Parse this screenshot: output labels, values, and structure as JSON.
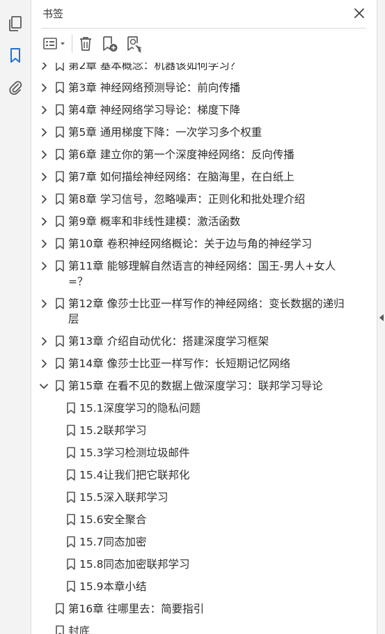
{
  "rail": {
    "items": [
      {
        "icon": "pages-icon"
      },
      {
        "icon": "bookmark-icon",
        "active": true
      },
      {
        "icon": "paperclip-icon"
      }
    ]
  },
  "panel": {
    "title": "书签"
  },
  "colors": {
    "icon": "#5a5a5a",
    "active_icon": "#1473e6",
    "text": "#2c2c2c",
    "scroll_thumb": "#c2c2c2"
  },
  "bookmarks": [
    {
      "label": "第2章 基本概念：机器该如何学习？",
      "expandable": true,
      "expanded": false
    },
    {
      "label": "第3章 神经网络预测导论：前向传播",
      "expandable": true,
      "expanded": false
    },
    {
      "label": "第4章 神经网络学习导论：梯度下降",
      "expandable": true,
      "expanded": false
    },
    {
      "label": "第5章 通用梯度下降：一次学习多个权重",
      "expandable": true,
      "expanded": false
    },
    {
      "label": "第6章 建立你的第一个深度神经网络：反向传播",
      "expandable": true,
      "expanded": false
    },
    {
      "label": "第7章 如何描绘神经网络：在脑海里，在白纸上",
      "expandable": true,
      "expanded": false
    },
    {
      "label": "第8章 学习信号，忽略噪声：正则化和批处理介绍",
      "expandable": true,
      "expanded": false
    },
    {
      "label": "第9章 概率和非线性建模：激活函数",
      "expandable": true,
      "expanded": false
    },
    {
      "label": "第10章 卷积神经网络概论：关于边与角的神经学习",
      "expandable": true,
      "expanded": false
    },
    {
      "label": "第11章 能够理解自然语言的神经网络：国王-男人+女人=？",
      "expandable": true,
      "expanded": false
    },
    {
      "label": "第12章 像莎士比亚一样写作的神经网络：变长数据的递归层",
      "expandable": true,
      "expanded": false
    },
    {
      "label": "第13章 介绍自动优化：搭建深度学习框架",
      "expandable": true,
      "expanded": false
    },
    {
      "label": "第14章 像莎士比亚一样写作：长短期记忆网络",
      "expandable": true,
      "expanded": false
    },
    {
      "label": "第15章 在看不见的数据上做深度学习：联邦学习导论",
      "expandable": true,
      "expanded": true,
      "children": [
        {
          "label": "15.1深度学习的隐私问题"
        },
        {
          "label": "15.2联邦学习"
        },
        {
          "label": "15.3学习检测垃圾邮件"
        },
        {
          "label": "15.4让我们把它联邦化"
        },
        {
          "label": "15.5深入联邦学习"
        },
        {
          "label": "15.6安全聚合"
        },
        {
          "label": "15.7同态加密"
        },
        {
          "label": "15.8同态加密联邦学习"
        },
        {
          "label": "15.9本章小结"
        }
      ]
    },
    {
      "label": "第16章 往哪里去：简要指引",
      "expandable": false,
      "expanded": false
    },
    {
      "label": "封底",
      "expandable": false,
      "expanded": false
    }
  ]
}
